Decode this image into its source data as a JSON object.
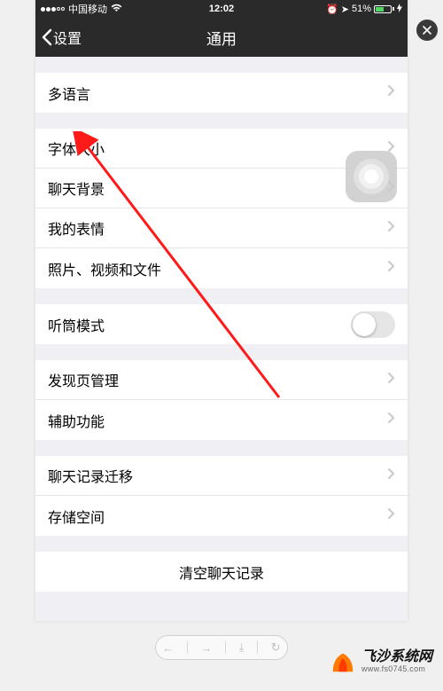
{
  "status_bar": {
    "carrier": "中国移动",
    "time": "12:02",
    "battery_pct": "51%"
  },
  "nav": {
    "back_label": "设置",
    "title": "通用"
  },
  "groups": [
    {
      "rows": [
        {
          "key": "multilang",
          "label": "多语言"
        }
      ]
    },
    {
      "rows": [
        {
          "key": "fontsize",
          "label": "字体大小"
        },
        {
          "key": "chatbg",
          "label": "聊天背景"
        },
        {
          "key": "stickers",
          "label": "我的表情"
        },
        {
          "key": "media",
          "label": "照片、视频和文件"
        }
      ]
    },
    {
      "rows": [
        {
          "key": "earpiece",
          "label": "听筒模式",
          "toggle": true,
          "on": false
        }
      ]
    },
    {
      "rows": [
        {
          "key": "discover",
          "label": "发现页管理"
        },
        {
          "key": "accessibility",
          "label": "辅助功能"
        }
      ]
    },
    {
      "rows": [
        {
          "key": "migrate",
          "label": "聊天记录迁移"
        },
        {
          "key": "storage",
          "label": "存储空间"
        }
      ]
    }
  ],
  "clear_button": "清空聊天记录",
  "watermark": {
    "name": "飞沙系统网",
    "url": "www.fs0745.com"
  }
}
